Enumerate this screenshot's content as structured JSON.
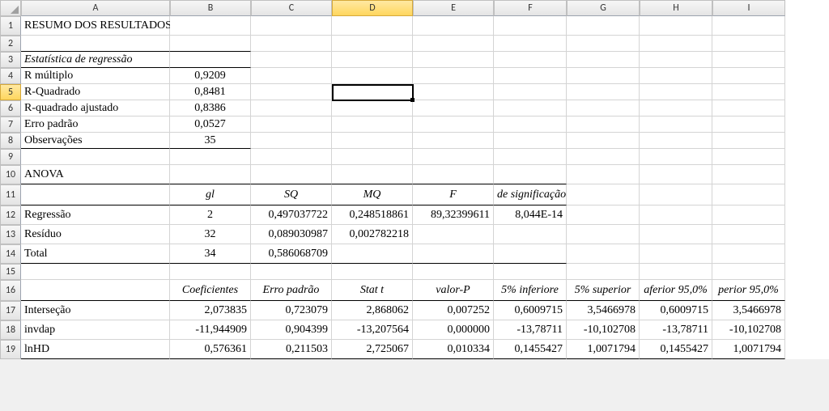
{
  "columns": [
    "A",
    "B",
    "C",
    "D",
    "E",
    "F",
    "G",
    "H",
    "I"
  ],
  "rows": [
    "1",
    "2",
    "3",
    "4",
    "5",
    "6",
    "7",
    "8",
    "9",
    "10",
    "11",
    "12",
    "13",
    "14",
    "15",
    "16",
    "17",
    "18",
    "19"
  ],
  "active_col_index": 3,
  "active_row_index": 4,
  "title": "RESUMO DOS RESULTADOS",
  "reg_stats": {
    "header": "Estatística de regressão",
    "rows": [
      {
        "label": "R múltiplo",
        "value": "0,9209"
      },
      {
        "label": "R-Quadrado",
        "value": "0,8481"
      },
      {
        "label": "R-quadrado ajustado",
        "value": "0,8386"
      },
      {
        "label": "Erro padrão",
        "value": "0,0527"
      },
      {
        "label": "Observações",
        "value": "35"
      }
    ]
  },
  "anova": {
    "header": "ANOVA",
    "cols": [
      "gl",
      "SQ",
      "MQ",
      "F",
      "de significação"
    ],
    "rows": [
      {
        "label": "Regressão",
        "gl": "2",
        "sq": "0,497037722",
        "mq": "0,248518861",
        "f": "89,32399611",
        "sig": "8,044E-14"
      },
      {
        "label": "Resíduo",
        "gl": "32",
        "sq": "0,089030987",
        "mq": "0,002782218",
        "f": "",
        "sig": ""
      },
      {
        "label": "Total",
        "gl": "34",
        "sq": "0,586068709",
        "mq": "",
        "f": "",
        "sig": ""
      }
    ]
  },
  "coef": {
    "cols": [
      "Coeficientes",
      "Erro padrão",
      "Stat t",
      "valor-P",
      "5% inferiore",
      "5% superior",
      "aferior 95,0%",
      "perior 95,0%"
    ],
    "rows": [
      {
        "label": "Interseção",
        "c": "2,073835",
        "ep": "0,723079",
        "t": "2,868062",
        "p": "0,007252",
        "li": "0,6009715",
        "ls": "3,5466978",
        "li2": "0,6009715",
        "ls2": "3,5466978"
      },
      {
        "label": "invdap",
        "c": "-11,944909",
        "ep": "0,904399",
        "t": "-13,207564",
        "p": "0,000000",
        "li": "-13,78711",
        "ls": "-10,102708",
        "li2": "-13,78711",
        "ls2": "-10,102708"
      },
      {
        "label": "lnHD",
        "c": "0,576361",
        "ep": "0,211503",
        "t": "2,725067",
        "p": "0,010334",
        "li": "0,1455427",
        "ls": "1,0071794",
        "li2": "0,1455427",
        "ls2": "1,0071794"
      }
    ]
  }
}
